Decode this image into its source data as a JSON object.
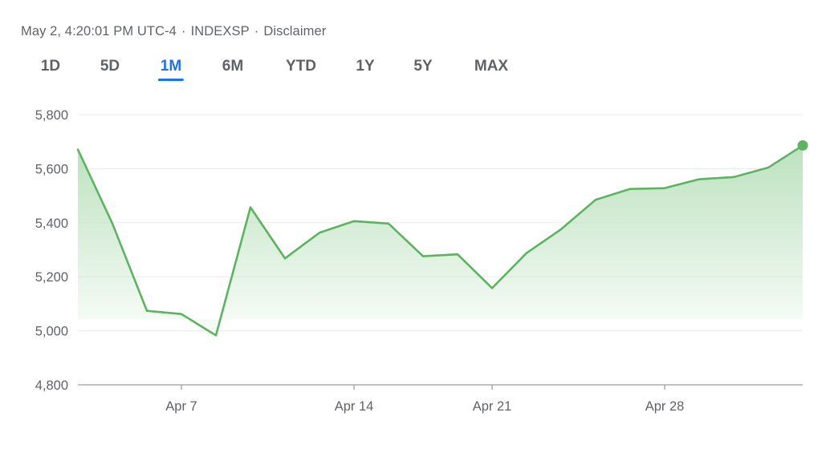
{
  "header": {
    "timestamp": "May 2, 4:20:01 PM UTC-4",
    "separator": "·",
    "index": "INDEXSP",
    "disclaimer": "Disclaimer"
  },
  "tabs": [
    {
      "label": "1D",
      "active": false
    },
    {
      "label": "5D",
      "active": false
    },
    {
      "label": "1M",
      "active": true
    },
    {
      "label": "6M",
      "active": false
    },
    {
      "label": "YTD",
      "active": false
    },
    {
      "label": "1Y",
      "active": false
    },
    {
      "label": "5Y",
      "active": false
    },
    {
      "label": "MAX",
      "active": false
    }
  ],
  "colors": {
    "line": "#5cb360",
    "fill_top": "#b9e0bb",
    "grid": "#ececec",
    "axis": "#9e9e9e",
    "active_tab": "#1a73e8"
  },
  "chart_data": {
    "type": "area",
    "title": "",
    "xlabel": "",
    "ylabel": "",
    "ylim": [
      4800,
      5800
    ],
    "yticks": [
      4800,
      5000,
      5200,
      5400,
      5600,
      5800
    ],
    "ytick_labels": [
      "4,800",
      "5,000",
      "5,200",
      "5,400",
      "5,600",
      "5,800"
    ],
    "xticks": [
      {
        "label": "Apr 7",
        "date": "2025-04-07"
      },
      {
        "label": "Apr 14",
        "date": "2025-04-14"
      },
      {
        "label": "Apr 21",
        "date": "2025-04-21"
      },
      {
        "label": "Apr 28",
        "date": "2025-04-28"
      }
    ],
    "x_range": [
      "2025-04-02",
      "2025-05-02"
    ],
    "grid": true,
    "series": [
      {
        "points": [
          {
            "date": "2025-04-02",
            "value": 5671
          },
          {
            "date": "2025-04-03",
            "value": 5397
          },
          {
            "date": "2025-04-04",
            "value": 5074
          },
          {
            "date": "2025-04-07",
            "value": 5062
          },
          {
            "date": "2025-04-08",
            "value": 4983
          },
          {
            "date": "2025-04-09",
            "value": 5457
          },
          {
            "date": "2025-04-10",
            "value": 5268
          },
          {
            "date": "2025-04-11",
            "value": 5363
          },
          {
            "date": "2025-04-14",
            "value": 5406
          },
          {
            "date": "2025-04-15",
            "value": 5397
          },
          {
            "date": "2025-04-16",
            "value": 5276
          },
          {
            "date": "2025-04-17",
            "value": 5283
          },
          {
            "date": "2025-04-21",
            "value": 5158
          },
          {
            "date": "2025-04-22",
            "value": 5288
          },
          {
            "date": "2025-04-23",
            "value": 5376
          },
          {
            "date": "2025-04-24",
            "value": 5485
          },
          {
            "date": "2025-04-25",
            "value": 5525
          },
          {
            "date": "2025-04-28",
            "value": 5528
          },
          {
            "date": "2025-04-29",
            "value": 5561
          },
          {
            "date": "2025-04-30",
            "value": 5569
          },
          {
            "date": "2025-05-01",
            "value": 5604
          },
          {
            "date": "2025-05-02",
            "value": 5686
          }
        ]
      }
    ]
  }
}
